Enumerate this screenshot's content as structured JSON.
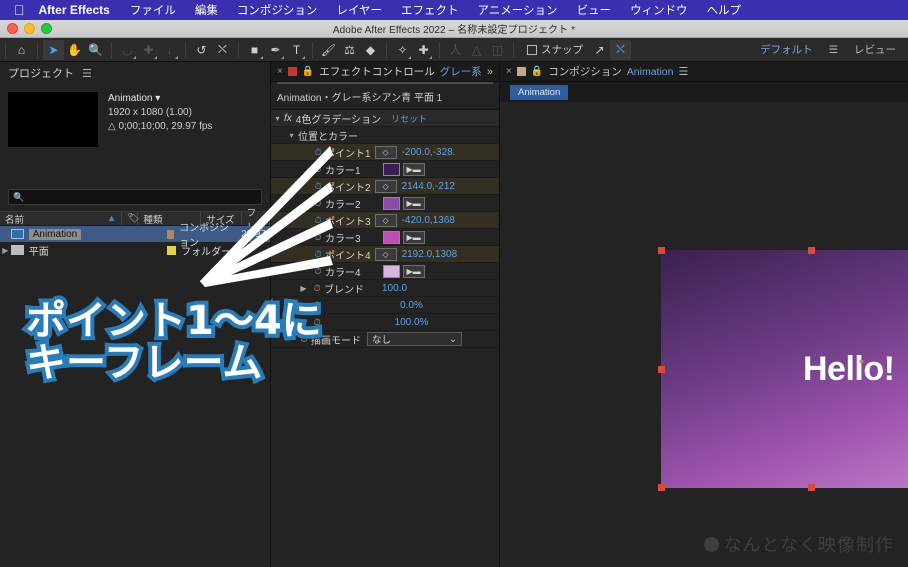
{
  "macmenu": {
    "apple_icon": "apple-icon",
    "appname": "After Effects",
    "items": [
      "ファイル",
      "編集",
      "コンポジション",
      "レイヤー",
      "エフェクト",
      "アニメーション",
      "ビュー",
      "ウィンドウ",
      "ヘルプ"
    ]
  },
  "window": {
    "title": "Adobe After Effects 2022 – 名称未設定プロジェクト *"
  },
  "toolbar": {
    "tools": [
      {
        "name": "home-icon",
        "glyph": "⌂"
      },
      {
        "name": "selection-tool-icon",
        "glyph": "➤"
      },
      {
        "name": "hand-tool-icon",
        "glyph": "✋"
      },
      {
        "name": "zoom-tool-icon",
        "glyph": "🔍"
      },
      {
        "name": "orbit-tool-icon",
        "glyph": "◠"
      },
      {
        "name": "pan-tool-icon",
        "glyph": "✛"
      },
      {
        "name": "dolly-tool-icon",
        "glyph": "↓"
      },
      {
        "name": "rotation-tool-icon",
        "glyph": "↺"
      },
      {
        "name": "anchor-point-tool-icon",
        "glyph": "⛶"
      },
      {
        "name": "shape-tool-icon",
        "glyph": "▢"
      },
      {
        "name": "pen-tool-icon",
        "glyph": "✒"
      },
      {
        "name": "type-tool-icon",
        "glyph": "T"
      },
      {
        "name": "brush-tool-icon",
        "glyph": "🖌"
      },
      {
        "name": "clone-stamp-tool-icon",
        "glyph": "⚱"
      },
      {
        "name": "eraser-tool-icon",
        "glyph": "◆"
      },
      {
        "name": "roto-brush-tool-icon",
        "glyph": "✧"
      },
      {
        "name": "puppet-pin-tool-icon",
        "glyph": "✚"
      }
    ],
    "rigging_tools": [
      {
        "name": "puppet-position-pin-icon",
        "glyph": "人"
      },
      {
        "name": "puppet-starch-pin-icon",
        "glyph": "人"
      },
      {
        "name": "puppet-overlap-pin-icon",
        "glyph": "⌾"
      }
    ],
    "snap_label": "スナップ",
    "align_icon": "align-icon",
    "transform_icon": "transform-box-icon",
    "workspace_default": "デフォルト",
    "workspace_menu_icon": "hamburger-icon",
    "workspace_review": "レビュー"
  },
  "project": {
    "title": "プロジェクト",
    "menu_icon": "panel-menu-icon",
    "item": {
      "name": "Animation",
      "dropdown_icon": "chevron-down-icon",
      "resolution": "1920 x 1080 (1.00)",
      "duration": "△ 0;00;10;00, 29.97 fps"
    },
    "search_placeholder": "",
    "search_icon": "search-icon",
    "columns": [
      "名前",
      "種類",
      "サイズ",
      "フレ..."
    ],
    "sort_icon": "sort-ascending-icon",
    "tag_icon": "label-tag-icon",
    "rows": [
      {
        "name": "Animation",
        "kind": "コンポジション",
        "size": "29.97",
        "selected": true,
        "icon": "composition-icon",
        "swatch": "#a88a62"
      },
      {
        "name": "平面",
        "kind": "フォルダー",
        "size": "",
        "selected": false,
        "icon": "folder-icon",
        "swatch": "#e4d24a"
      }
    ]
  },
  "effect_controls": {
    "tab_title": "エフェクトコントロール",
    "tab_layer": "グレー系",
    "close_icon": "close-icon",
    "lock_icon": "lock-icon",
    "expand_icon": "chevron-double-right-icon",
    "swatch_color": "#c4392f",
    "layer_path": "Animation・グレー系シアン青 平面 1",
    "effect_name": "4色グラデーション",
    "effect_icon": "fx-icon",
    "reset_label": "リセット",
    "group_label": "位置とカラー",
    "properties": [
      {
        "label": "ポイント1",
        "value": "-200.0,-328.",
        "type": "point",
        "keyframed": true,
        "kfnav_icon": "keyframe-nav-icon"
      },
      {
        "label": "カラー1",
        "value": "",
        "type": "color",
        "color": "#3a1f55",
        "keyframed": false,
        "eyedropper_icon": "eyedropper-icon"
      },
      {
        "label": "ポイント2",
        "value": "2144.0,-212",
        "type": "point",
        "keyframed": true,
        "kfnav_icon": "keyframe-nav-icon"
      },
      {
        "label": "カラー2",
        "value": "",
        "type": "color",
        "color": "#8e4aa8",
        "keyframed": false,
        "eyedropper_icon": "eyedropper-icon"
      },
      {
        "label": "ポイント3",
        "value": "-420.0,1368",
        "type": "point",
        "keyframed": true,
        "kfnav_icon": "keyframe-nav-icon"
      },
      {
        "label": "カラー3",
        "value": "",
        "type": "color",
        "color": "#bd4fb4",
        "keyframed": false,
        "eyedropper_icon": "eyedropper-icon"
      },
      {
        "label": "ポイント4",
        "value": "2192.0,1308",
        "type": "point",
        "keyframed": true,
        "kfnav_icon": "keyframe-nav-icon"
      },
      {
        "label": "カラー4",
        "value": "",
        "type": "color",
        "color": "#d9b6e2",
        "keyframed": false,
        "eyedropper_icon": "eyedropper-icon"
      }
    ],
    "extra_rows": [
      {
        "label": "ブレンド",
        "value": "100.0",
        "twirl": true
      },
      {
        "label": "",
        "value": "0.0%",
        "twirl": true
      },
      {
        "label": "",
        "value": "100.0%",
        "twirl": true
      }
    ],
    "blend_mode_label": "描画モード",
    "blend_mode_value": "なし",
    "blend_mode_icon": "chevron-down-icon"
  },
  "composition": {
    "tab_title": "コンポジション",
    "comp_name": "Animation",
    "close_icon": "close-icon",
    "lock_icon": "lock-icon",
    "menu_icon": "panel-menu-icon",
    "swatch_color": "#c3a986",
    "tab_chip": "Animation",
    "viewer": {
      "text_layer": "Hello!",
      "gradient_colors": [
        "#3a2150",
        "#6d3c86",
        "#a055ae",
        "#c07fcb"
      ],
      "handle_color": "#d94a3d",
      "anchor_icon": "anchor-point-icon"
    }
  },
  "annotation": {
    "line1": "ポイント1〜4に",
    "line2": "キーフレーム",
    "fill_color": "#ffffff",
    "stroke_color": "#2a7cb8",
    "arrow_color": "#ffffff",
    "arrow_count": 4
  },
  "watermark": {
    "text": "なんとなく映像制作",
    "icon": "aperture-icon"
  }
}
